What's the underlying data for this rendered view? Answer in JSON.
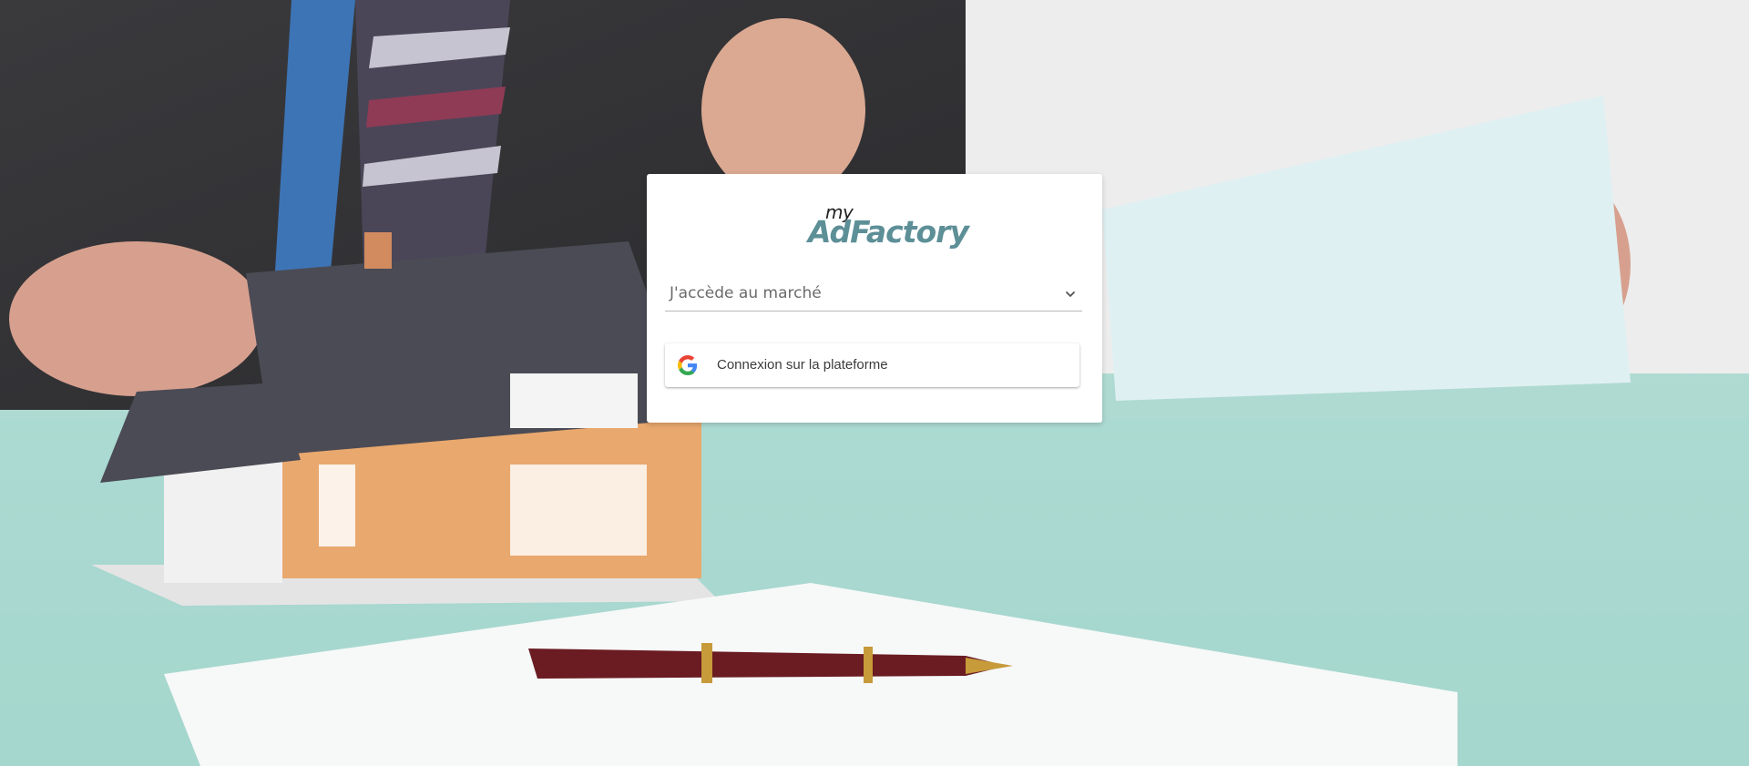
{
  "logo": {
    "prefix": "my",
    "name": "AdFactory"
  },
  "market_select": {
    "value": "J'accède au marché",
    "icon": "chevron-down-icon"
  },
  "login_button": {
    "label": "Connexion sur la plateforme",
    "icon": "google-icon"
  },
  "colors": {
    "brand": "#5d8f97",
    "card_bg": "#ffffff",
    "label_text": "#3c3c3c"
  }
}
